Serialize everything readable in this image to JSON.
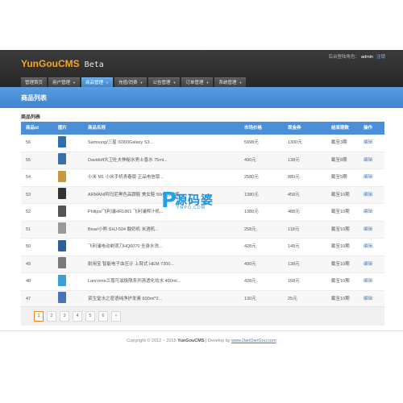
{
  "header": {
    "brand": "YunGouCMS",
    "beta": "Beta",
    "user_prefix": "后台登陆角色：",
    "username": "admin",
    "logout": "注销"
  },
  "nav": [
    {
      "label": "管理首页",
      "has_caret": false,
      "active": false
    },
    {
      "label": "用户管理",
      "has_caret": true,
      "active": false
    },
    {
      "label": "商品管理",
      "has_caret": true,
      "active": true
    },
    {
      "label": "充值/消费",
      "has_caret": true,
      "active": false
    },
    {
      "label": "公告管理",
      "has_caret": true,
      "active": false
    },
    {
      "label": "订单管理",
      "has_caret": true,
      "active": false
    },
    {
      "label": "系统管理",
      "has_caret": true,
      "active": false
    }
  ],
  "page_title": "商品列表",
  "section_label": "商品列表",
  "table": {
    "headers": [
      "商品id",
      "图片",
      "商品名称",
      "市场价格",
      "现金券",
      "结束期数",
      "操作"
    ],
    "rows": [
      {
        "id": "56",
        "thumb": "#2f6fb0",
        "name": "Samsung/三星 I9300Galaxy S3...",
        "price": "5998元",
        "coupon": "1300元",
        "end": "截至3期",
        "op": "编辑"
      },
      {
        "id": "55",
        "thumb": "#3a6ea8",
        "name": "Davidoff大卫杜夫神秘水男士香水 75ml...",
        "price": "490元",
        "coupon": "138元",
        "end": "截至8期",
        "op": "编辑"
      },
      {
        "id": "54",
        "thumb": "#c99a3c",
        "name": "小米 M1 小米手机青春版 正品电信版...",
        "price": "2580元",
        "coupon": "880元",
        "end": "截至5期",
        "op": "编辑"
      },
      {
        "id": "53",
        "thumb": "#333333",
        "name": "ARMANI阿玛尼黑色高跟鞋 美女鞋 50ml抗敏感...",
        "price": "1380元",
        "coupon": "458元",
        "end": "截至10期",
        "op": "编辑"
      },
      {
        "id": "52",
        "thumb": "#555555",
        "name": "Philips/飞利浦HR1861 飞利浦榨汁机...",
        "price": "1380元",
        "coupon": "488元",
        "end": "截至10期",
        "op": "编辑"
      },
      {
        "id": "51",
        "thumb": "#9a9a9a",
        "name": "Bear/小熊 SHJ-504 酸奶机 米酒机...",
        "price": "258元",
        "coupon": "118元",
        "end": "截至10期",
        "op": "编辑"
      },
      {
        "id": "50",
        "thumb": "#2b5f9e",
        "name": "飞利浦电动剃须刀HQ6070 全身水洗...",
        "price": "428元",
        "coupon": "148元",
        "end": "截至10期",
        "op": "编辑"
      },
      {
        "id": "49",
        "thumb": "#7a7a7a",
        "name": "耐用宝 智能电子血压计 上臂式 HEM-7200...",
        "price": "490元",
        "coupon": "138元",
        "end": "截至10期",
        "op": "编辑"
      },
      {
        "id": "48",
        "thumb": "#3aa0d8",
        "name": "Lancome兰蔻可滋极限系列清透化妆水 400ml...",
        "price": "428元",
        "coupon": "168元",
        "end": "截至10期",
        "op": "编辑"
      },
      {
        "id": "47",
        "thumb": "#4a72b8",
        "name": "资生堂水之密语纯净护发素 600ml*2...",
        "price": "130元",
        "coupon": "25元",
        "end": "截至10期",
        "op": "编辑"
      }
    ]
  },
  "pagination": {
    "pages": [
      "1",
      "2",
      "3",
      "4",
      "5",
      "6",
      "»"
    ],
    "current": "1"
  },
  "footer": {
    "copyright": "Copyright © 2012 ~ 2015",
    "brand": "YunGouCMS",
    "separator": "| Develop by",
    "link": "www.DanDanGou.com"
  },
  "watermark": {
    "letter": "P",
    "text": "源码婆",
    "url": "YMPO.COM"
  }
}
